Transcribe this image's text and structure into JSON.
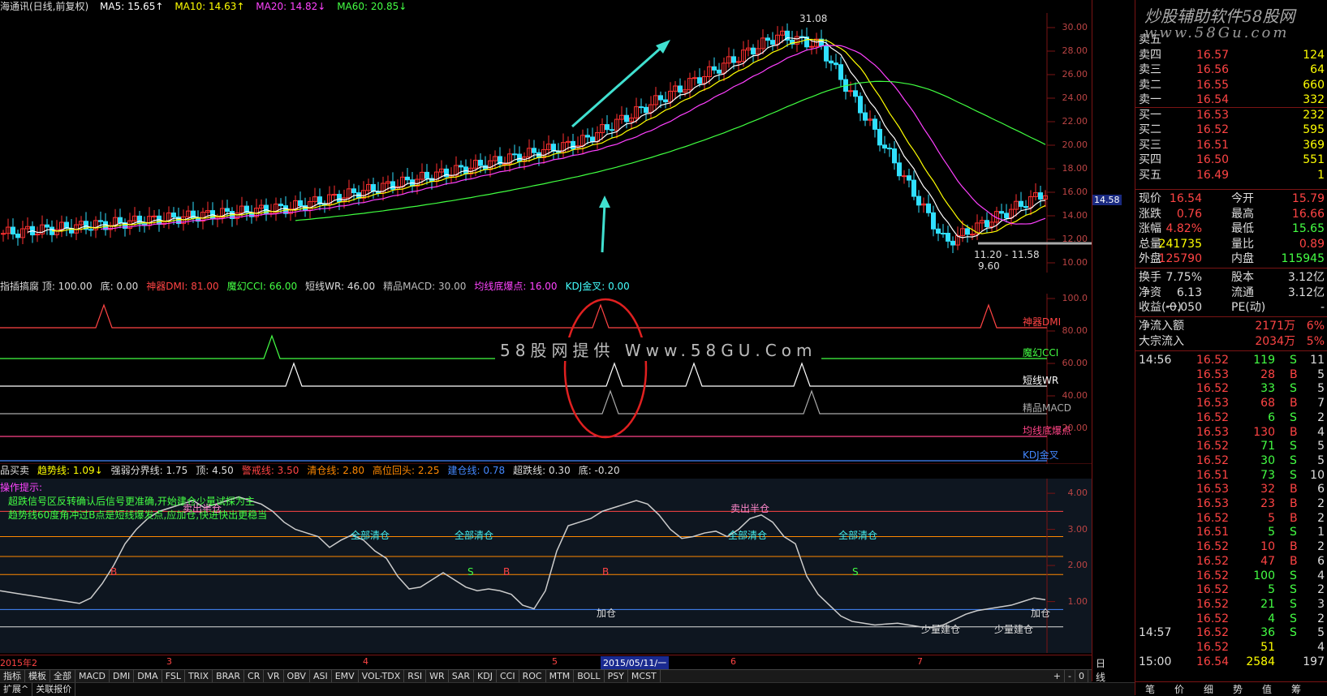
{
  "header": {
    "stock_title": "海通讯(日线,前复权)",
    "ma5": "MA5: 15.65↑",
    "ma10": "MA10: 14.63↑",
    "ma20": "MA20: 14.82↓",
    "ma60": "MA60: 20.85↓"
  },
  "colors": {
    "ma5": "#ffffff",
    "ma10": "#ffff00",
    "ma20": "#ff40ff",
    "ma60": "#40ff40",
    "up": "#ff3030",
    "down": "#30e0ff",
    "grid": "#7a1414"
  },
  "price_axis": {
    "ticks": [
      "30.00",
      "28.00",
      "26.00",
      "24.00",
      "22.00",
      "20.00",
      "18.00",
      "16.00",
      "14.00",
      "12.00",
      "10.00"
    ],
    "current": "14.58"
  },
  "price_annotations": {
    "high": "31.08",
    "low": "9.60",
    "range": "11.20 - 11.58"
  },
  "indicator": {
    "legend": [
      "指插搞腐 顶: 100.00",
      "底: 0.00",
      "神器DMI: 81.00",
      "魔幻CCI: 66.00",
      "短线WR: 46.00",
      "精品MACD: 30.00",
      "均线底爆点: 16.00",
      "KDJ金叉: 0.00"
    ],
    "axis": [
      "100.0",
      "80.00",
      "60.00",
      "40.00",
      "20.00"
    ],
    "lines": [
      "神器DMI",
      "魔幻CCI",
      "短线WR",
      "精品MACD",
      "均线底爆点",
      "KDJ金叉"
    ],
    "watermark": "58股网提供 Www.58GU.Com"
  },
  "signal": {
    "legend": [
      "品买卖",
      "趋势线: 1.09↓",
      "强弱分界线: 1.75",
      "顶: 4.50",
      "警戒线: 3.50",
      "清仓线: 2.80",
      "高位回头: 2.25",
      "建仓线: 0.78",
      "超跌线: 0.30",
      "底: -0.20"
    ],
    "notes": [
      "操作提示:",
      "超跌信号区反转确认后信号更准确,开始建仓少量试探为主",
      "趋势线60度角冲过B点是短线爆发点,应加仓,快进快出更稳当"
    ],
    "axis": [
      "4.00",
      "3.00",
      "2.00",
      "1.00"
    ],
    "labels": {
      "sell_half": "卖出半仓",
      "clear_all": "全部清仓",
      "add": "加仓",
      "small_build": "少量建仓",
      "s": "S",
      "b": "B"
    }
  },
  "date_axis": {
    "labels": [
      "2015年2",
      "3",
      "4",
      "5",
      "2015/05/11/一",
      "6",
      "7"
    ],
    "period": "日线"
  },
  "bottom_tabs": [
    "指标",
    "模板",
    "全部",
    "MACD",
    "DMI",
    "DMA",
    "FSL",
    "TRIX",
    "BRAR",
    "CR",
    "VR",
    "OBV",
    "ASI",
    "EMV",
    "VOL-TDX",
    "RSI",
    "WR",
    "SAR",
    "KDJ",
    "CCI",
    "ROC",
    "MTM",
    "BOLL",
    "PSY",
    "MCST"
  ],
  "bottom_right": [
    "+",
    "-",
    "0"
  ],
  "status": [
    "扩展^",
    "关联报价"
  ],
  "panel": {
    "watermark": "炒股辅助软件58股网",
    "watermark_url": "www.58Gu.com",
    "order_book": [
      {
        "label": "卖五",
        "price": "",
        "vol": ""
      },
      {
        "label": "卖四",
        "price": "16.57",
        "vol": "124"
      },
      {
        "label": "卖三",
        "price": "16.56",
        "vol": "64"
      },
      {
        "label": "卖二",
        "price": "16.55",
        "vol": "660"
      },
      {
        "label": "卖一",
        "price": "16.54",
        "vol": "332"
      },
      {
        "label": "买一",
        "price": "16.53",
        "vol": "232"
      },
      {
        "label": "买二",
        "price": "16.52",
        "vol": "595"
      },
      {
        "label": "买三",
        "price": "16.51",
        "vol": "369"
      },
      {
        "label": "买四",
        "price": "16.50",
        "vol": "551"
      },
      {
        "label": "买五",
        "price": "16.49",
        "vol": "1"
      }
    ],
    "quote": [
      {
        "l1": "现价",
        "v1": "16.54",
        "l2": "今开",
        "v2": "15.79"
      },
      {
        "l1": "涨跌",
        "v1": "0.76",
        "l2": "最高",
        "v2": "16.66"
      },
      {
        "l1": "涨幅",
        "v1": "4.82%",
        "l2": "最低",
        "v2": "15.65"
      },
      {
        "l1": "总量",
        "v1": "241735",
        "l2": "量比",
        "v2": "0.89"
      },
      {
        "l1": "外盘",
        "v1": "125790",
        "l2": "内盘",
        "v2": "115945"
      }
    ],
    "stats": [
      {
        "l1": "换手",
        "v1": "7.75%",
        "l2": "股本",
        "v2": "3.12亿"
      },
      {
        "l1": "净资",
        "v1": "6.13",
        "l2": "流通",
        "v2": "3.12亿"
      },
      {
        "l1": "收益(一)",
        "v1": "-0.050",
        "l2": "PE(动)",
        "v2": "-"
      }
    ],
    "flows": [
      {
        "label": "净流入额",
        "value": "2171万",
        "pct": "6%"
      },
      {
        "label": "大宗流入",
        "value": "2034万",
        "pct": "5%"
      }
    ],
    "ticks": [
      {
        "t": "14:56",
        "p": "16.52",
        "v": "119",
        "s": "S",
        "n": "11"
      },
      {
        "t": "",
        "p": "16.53",
        "v": "28",
        "s": "B",
        "n": "5"
      },
      {
        "t": "",
        "p": "16.52",
        "v": "33",
        "s": "S",
        "n": "5"
      },
      {
        "t": "",
        "p": "16.53",
        "v": "68",
        "s": "B",
        "n": "7"
      },
      {
        "t": "",
        "p": "16.52",
        "v": "6",
        "s": "S",
        "n": "2"
      },
      {
        "t": "",
        "p": "16.53",
        "v": "130",
        "s": "B",
        "n": "4"
      },
      {
        "t": "",
        "p": "16.52",
        "v": "71",
        "s": "S",
        "n": "5"
      },
      {
        "t": "",
        "p": "16.52",
        "v": "30",
        "s": "S",
        "n": "5"
      },
      {
        "t": "",
        "p": "16.51",
        "v": "73",
        "s": "S",
        "n": "10"
      },
      {
        "t": "",
        "p": "16.53",
        "v": "32",
        "s": "B",
        "n": "6"
      },
      {
        "t": "",
        "p": "16.53",
        "v": "23",
        "s": "B",
        "n": "2"
      },
      {
        "t": "",
        "p": "16.52",
        "v": "5",
        "s": "B",
        "n": "2"
      },
      {
        "t": "",
        "p": "16.51",
        "v": "5",
        "s": "S",
        "n": "1"
      },
      {
        "t": "",
        "p": "16.52",
        "v": "10",
        "s": "B",
        "n": "2"
      },
      {
        "t": "",
        "p": "16.52",
        "v": "47",
        "s": "B",
        "n": "6"
      },
      {
        "t": "",
        "p": "16.52",
        "v": "100",
        "s": "S",
        "n": "4"
      },
      {
        "t": "",
        "p": "16.52",
        "v": "5",
        "s": "S",
        "n": "2"
      },
      {
        "t": "",
        "p": "16.52",
        "v": "21",
        "s": "S",
        "n": "3"
      },
      {
        "t": "",
        "p": "16.52",
        "v": "4",
        "s": "S",
        "n": "2"
      },
      {
        "t": "14:57",
        "p": "16.52",
        "v": "36",
        "s": "S",
        "n": "5"
      },
      {
        "t": "",
        "p": "16.52",
        "v": "51",
        "s": "",
        "n": "4"
      },
      {
        "t": "15:00",
        "p": "16.54",
        "v": "2584",
        "s": "",
        "n": "197"
      }
    ],
    "footer_tabs": [
      "笔",
      "价",
      "细",
      "势",
      "值",
      "筹"
    ]
  }
}
